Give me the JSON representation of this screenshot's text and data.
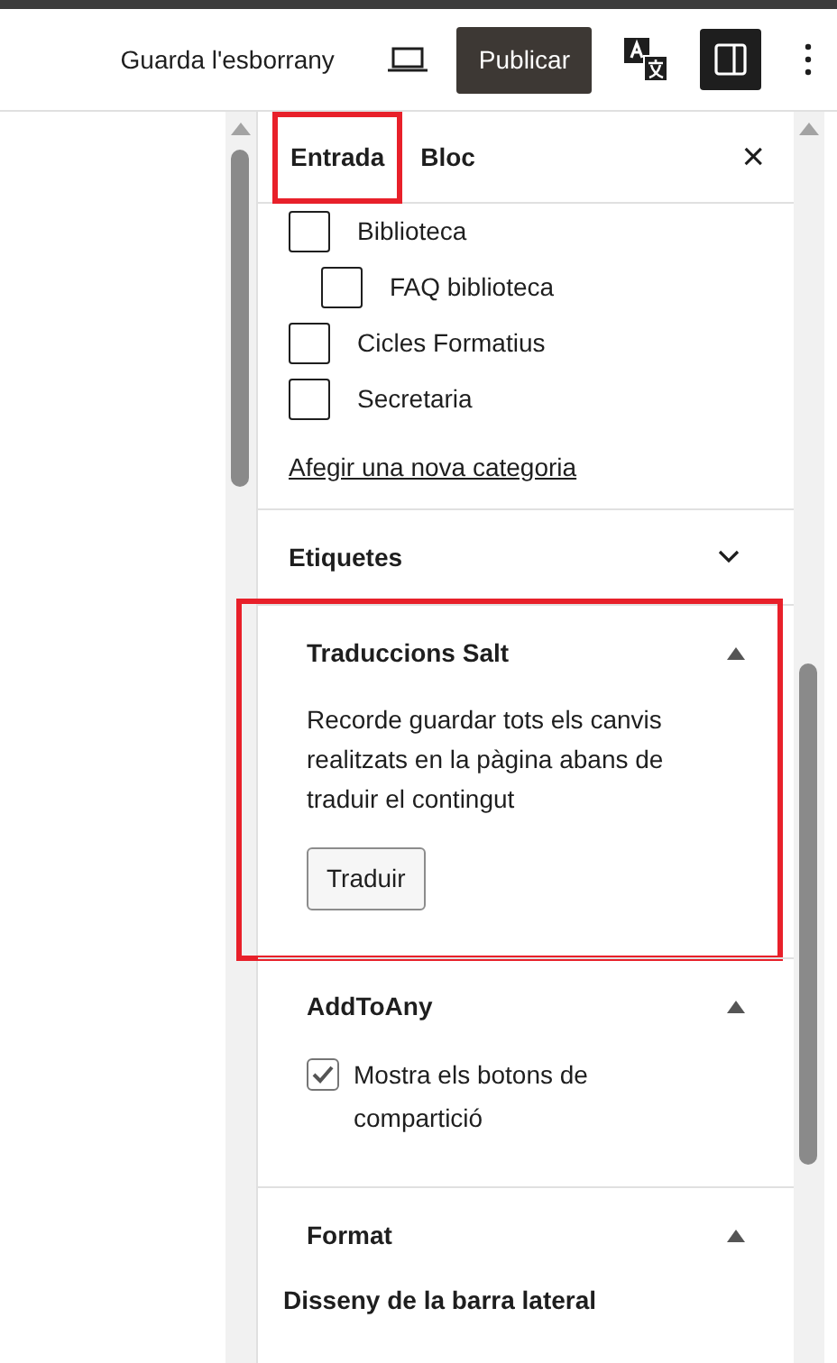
{
  "toolbar": {
    "save_draft": "Guarda l'esborrany",
    "publish": "Publicar",
    "sidebar_open": true
  },
  "tabs": [
    {
      "label": "Entrada",
      "selected": true,
      "highlighted": true
    },
    {
      "label": "Bloc",
      "selected": false,
      "highlighted": false
    }
  ],
  "close": "×",
  "categories": [
    {
      "label": "Biblioteca",
      "checked": false,
      "children": [
        {
          "label": "FAQ biblioteca",
          "checked": false
        }
      ]
    },
    {
      "label": "Cicles Formatius",
      "checked": false
    },
    {
      "label": "Secretaria",
      "checked": false
    }
  ],
  "add_category_link": "Afegir una nova categoria",
  "panels": [
    {
      "title": "Etiquetes",
      "expanded": false,
      "highlighted": false
    },
    {
      "title": "Traduccions Salt",
      "expanded": true,
      "highlighted": true,
      "kind": "text",
      "text": "Recorde guardar tots els canvis realitzats en la pàgina abans de traduir el contingut",
      "button": "Traduir"
    },
    {
      "title": "AddToAny",
      "expanded": true,
      "highlighted": false,
      "kind": "checkbox",
      "checkbox": {
        "label": "Mostra els botons de compartició",
        "checked": true
      }
    },
    {
      "title": "Format",
      "expanded": true,
      "highlighted": false,
      "kind": "subheading",
      "subheading": "Disseny de la barra lateral"
    }
  ]
}
